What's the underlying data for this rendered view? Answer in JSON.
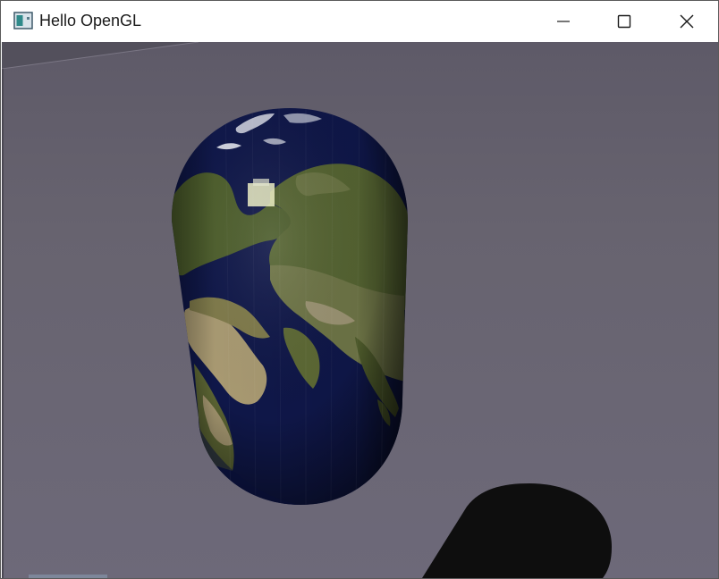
{
  "window": {
    "title": "Hello OpenGL",
    "app_icon": "opengl-window-icon"
  },
  "caption_buttons": {
    "minimize_icon": "minimize-icon",
    "maximize_icon": "maximize-icon",
    "close_icon": "close-icon"
  },
  "scene": {
    "background_color": "#6b6775",
    "floor_color": "#605c6a",
    "object": "earth-textured-capsule",
    "shadow": "capsule-shadow",
    "ocean_color": "#0e1646",
    "land_color": "#4a5a2a",
    "desert_color": "#a89a78",
    "shadow_color": "#0e0e0e"
  }
}
